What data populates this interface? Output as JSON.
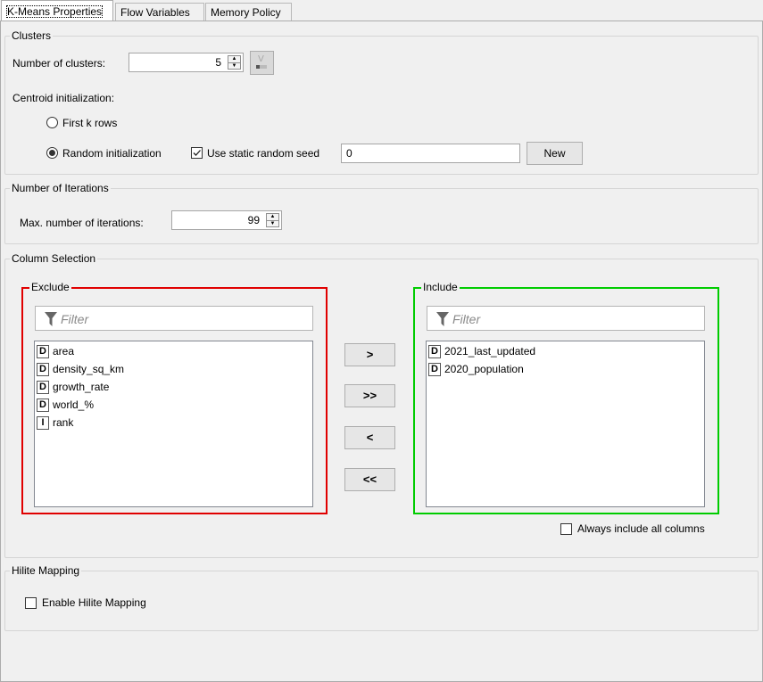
{
  "tabs": [
    "K-Means Properties",
    "Flow Variables",
    "Memory Policy"
  ],
  "clusters": {
    "title": "Clusters",
    "num_label": "Number of clusters:",
    "num_value": "5",
    "init_label": "Centroid initialization:",
    "first_k": "First k rows",
    "random": "Random initialization",
    "static_seed": "Use static random seed",
    "seed_value": "0",
    "new_btn": "New"
  },
  "iterations": {
    "title": "Number of Iterations",
    "label": "Max. number of iterations:",
    "value": "99"
  },
  "columns": {
    "title": "Column Selection",
    "exclude_title": "Exclude",
    "include_title": "Include",
    "filter_placeholder": "Filter",
    "exclude": [
      {
        "type": "D",
        "name": "area"
      },
      {
        "type": "D",
        "name": "density_sq_km"
      },
      {
        "type": "D",
        "name": "growth_rate"
      },
      {
        "type": "D",
        "name": "world_%"
      },
      {
        "type": "I",
        "name": "rank"
      }
    ],
    "include": [
      {
        "type": "D",
        "name": "2021_last_updated"
      },
      {
        "type": "D",
        "name": "2020_population"
      }
    ],
    "buttons": [
      ">",
      ">>",
      "<",
      "<<"
    ],
    "always_include": "Always include all columns"
  },
  "hilite": {
    "title": "Hilite Mapping",
    "enable": "Enable Hilite Mapping"
  },
  "colors": {
    "exclude_border": "#e00000",
    "include_border": "#00cc00"
  }
}
